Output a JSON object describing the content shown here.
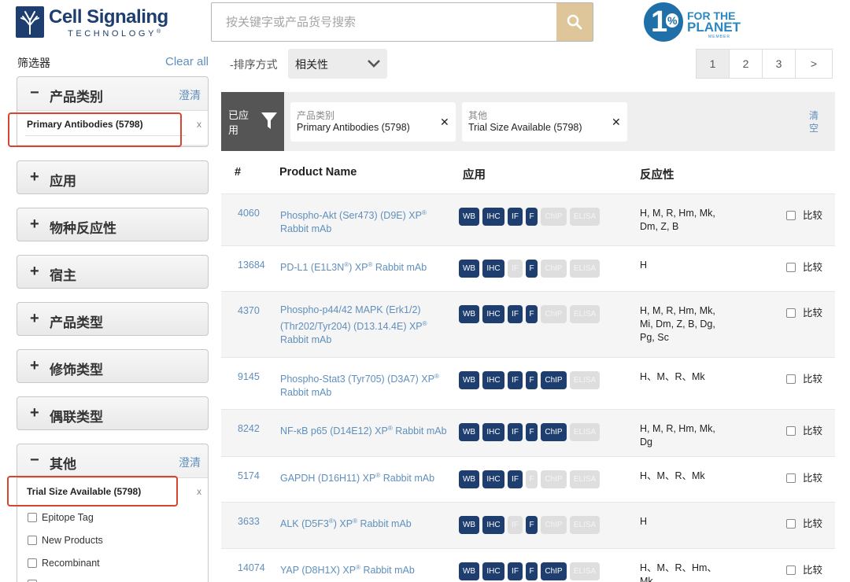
{
  "brand": {
    "title": "Cell Signaling",
    "subtitle": "TECHNOLOGY",
    "tm": "®",
    "color": "#1d3e6e"
  },
  "search": {
    "placeholder": "按关键字或产品货号搜索",
    "button_icon": "search-icon",
    "button_color": "#dfc59a"
  },
  "partner": {
    "one": "1",
    "pct": "%",
    "line1": "FOR THE",
    "line2": "PLANET",
    "line3": "MEMBER"
  },
  "sidebar": {
    "filter_label": "筛选器",
    "clear_all": "Clear all",
    "facets": [
      {
        "sign": "−",
        "title": "产品类别",
        "clear": "澄清",
        "chip": "Primary Antibodies (5798)",
        "chip_x": "x"
      },
      {
        "sign": "+",
        "title": "应用"
      },
      {
        "sign": "+",
        "title": "物种反应性"
      },
      {
        "sign": "+",
        "title": "宿主"
      },
      {
        "sign": "+",
        "title": "产品类型"
      },
      {
        "sign": "+",
        "title": "修饰类型"
      },
      {
        "sign": "+",
        "title": "偶联类型"
      },
      {
        "sign": "−",
        "title": "其他",
        "clear": "澄清",
        "chip": "Trial Size Available (5798)",
        "chip_x": "x"
      }
    ],
    "other_options": [
      "Epitope Tag",
      "New Products",
      "Recombinant"
    ]
  },
  "sort": {
    "label": "-排序方式",
    "value": "相关性"
  },
  "pagination": {
    "pages": [
      "1",
      "2",
      "3"
    ],
    "next": ">",
    "current": "1"
  },
  "applied_filters": {
    "label": "已应用",
    "chips": [
      {
        "category": "产品类别",
        "value": "Primary Antibodies (5798)",
        "x": "✕"
      },
      {
        "category": "其他",
        "value": "Trial Size Available (5798)",
        "x": "✕"
      }
    ],
    "clear": "清空"
  },
  "table": {
    "headers": {
      "id": "#",
      "name": "Product Name",
      "apps": "应用",
      "reactivity": "反应性"
    },
    "compare_label": "比较",
    "rows": [
      {
        "id": "4060",
        "name": "Phospho-Akt (Ser473) (D9E) XP® Rabbit mAb",
        "apps": {
          "WB": true,
          "IHC": true,
          "IF": true,
          "F": true,
          "ChIP": false,
          "ELISA": false
        },
        "reactivity": "H, M, R, Hm, Mk, Dm, Z, B"
      },
      {
        "id": "13684",
        "name": "PD-L1 (E1L3N®) XP® Rabbit mAb",
        "apps": {
          "WB": true,
          "IHC": true,
          "IF": false,
          "F": true,
          "ChIP": false,
          "ELISA": false
        },
        "reactivity": "H"
      },
      {
        "id": "4370",
        "name": "Phospho-p44/42 MAPK (Erk1/2) (Thr202/Tyr204) (D13.14.4E) XP® Rabbit mAb",
        "apps": {
          "WB": true,
          "IHC": true,
          "IF": true,
          "F": true,
          "ChIP": false,
          "ELISA": false
        },
        "reactivity": "H, M, R, Hm, Mk, Mi, Dm, Z, B, Dg, Pg, Sc"
      },
      {
        "id": "9145",
        "name": "Phospho-Stat3 (Tyr705) (D3A7) XP® Rabbit mAb",
        "apps": {
          "WB": true,
          "IHC": true,
          "IF": true,
          "F": true,
          "ChIP": true,
          "ELISA": false
        },
        "reactivity": "H、M、R、Mk"
      },
      {
        "id": "8242",
        "name": "NF-κB p65 (D14E12) XP® Rabbit mAb",
        "apps": {
          "WB": true,
          "IHC": true,
          "IF": true,
          "F": true,
          "ChIP": true,
          "ELISA": false
        },
        "reactivity": "H, M, R, Hm, Mk, Dg"
      },
      {
        "id": "5174",
        "name": "GAPDH (D16H11) XP® Rabbit mAb",
        "apps": {
          "WB": true,
          "IHC": true,
          "IF": true,
          "F": false,
          "ChIP": false,
          "ELISA": false
        },
        "reactivity": "H、M、R、Mk"
      },
      {
        "id": "3633",
        "name": "ALK (D5F3®) XP® Rabbit mAb",
        "apps": {
          "WB": true,
          "IHC": true,
          "IF": false,
          "F": true,
          "ChIP": false,
          "ELISA": false
        },
        "reactivity": "H"
      },
      {
        "id": "14074",
        "name": "YAP (D8H1X) XP® Rabbit mAb",
        "apps": {
          "WB": true,
          "IHC": true,
          "IF": true,
          "F": true,
          "ChIP": true,
          "ELISA": false
        },
        "reactivity": "H、M、R、Hm、Mk"
      }
    ]
  },
  "colors": {
    "link": "#5f8fbd",
    "badge_on": "#1d3e6e",
    "badge_off": "#dedede",
    "highlight": "#d7442f"
  }
}
